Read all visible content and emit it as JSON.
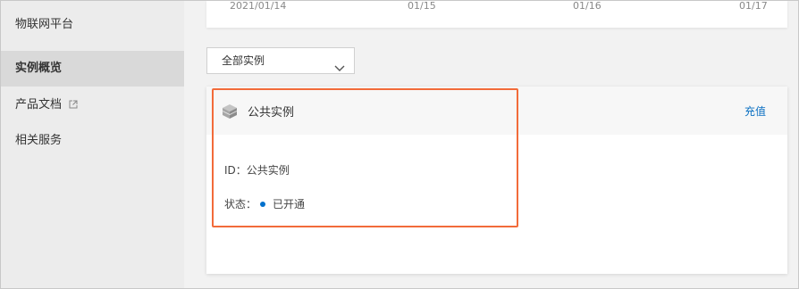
{
  "sidebar": {
    "title": "物联网平台",
    "items": [
      {
        "label": "实例概览",
        "active": true
      },
      {
        "label": "产品文档",
        "external": true
      },
      {
        "label": "相关服务"
      }
    ]
  },
  "chart": {
    "x_ticks": [
      "2021/01/14",
      "01/15",
      "01/16",
      "01/17"
    ]
  },
  "filter": {
    "selected": "全部实例",
    "icon": "chevron-down-icon"
  },
  "instance_card": {
    "icon": "cube-icon",
    "title": "公共实例",
    "action": "充值",
    "id_label": "ID：",
    "id_value": "公共实例",
    "status_label": "状态：",
    "status_value": "已开通",
    "status_color": "#0070cc",
    "action_color": "#0a6fc2",
    "highlight_color": "#f26b3a"
  }
}
